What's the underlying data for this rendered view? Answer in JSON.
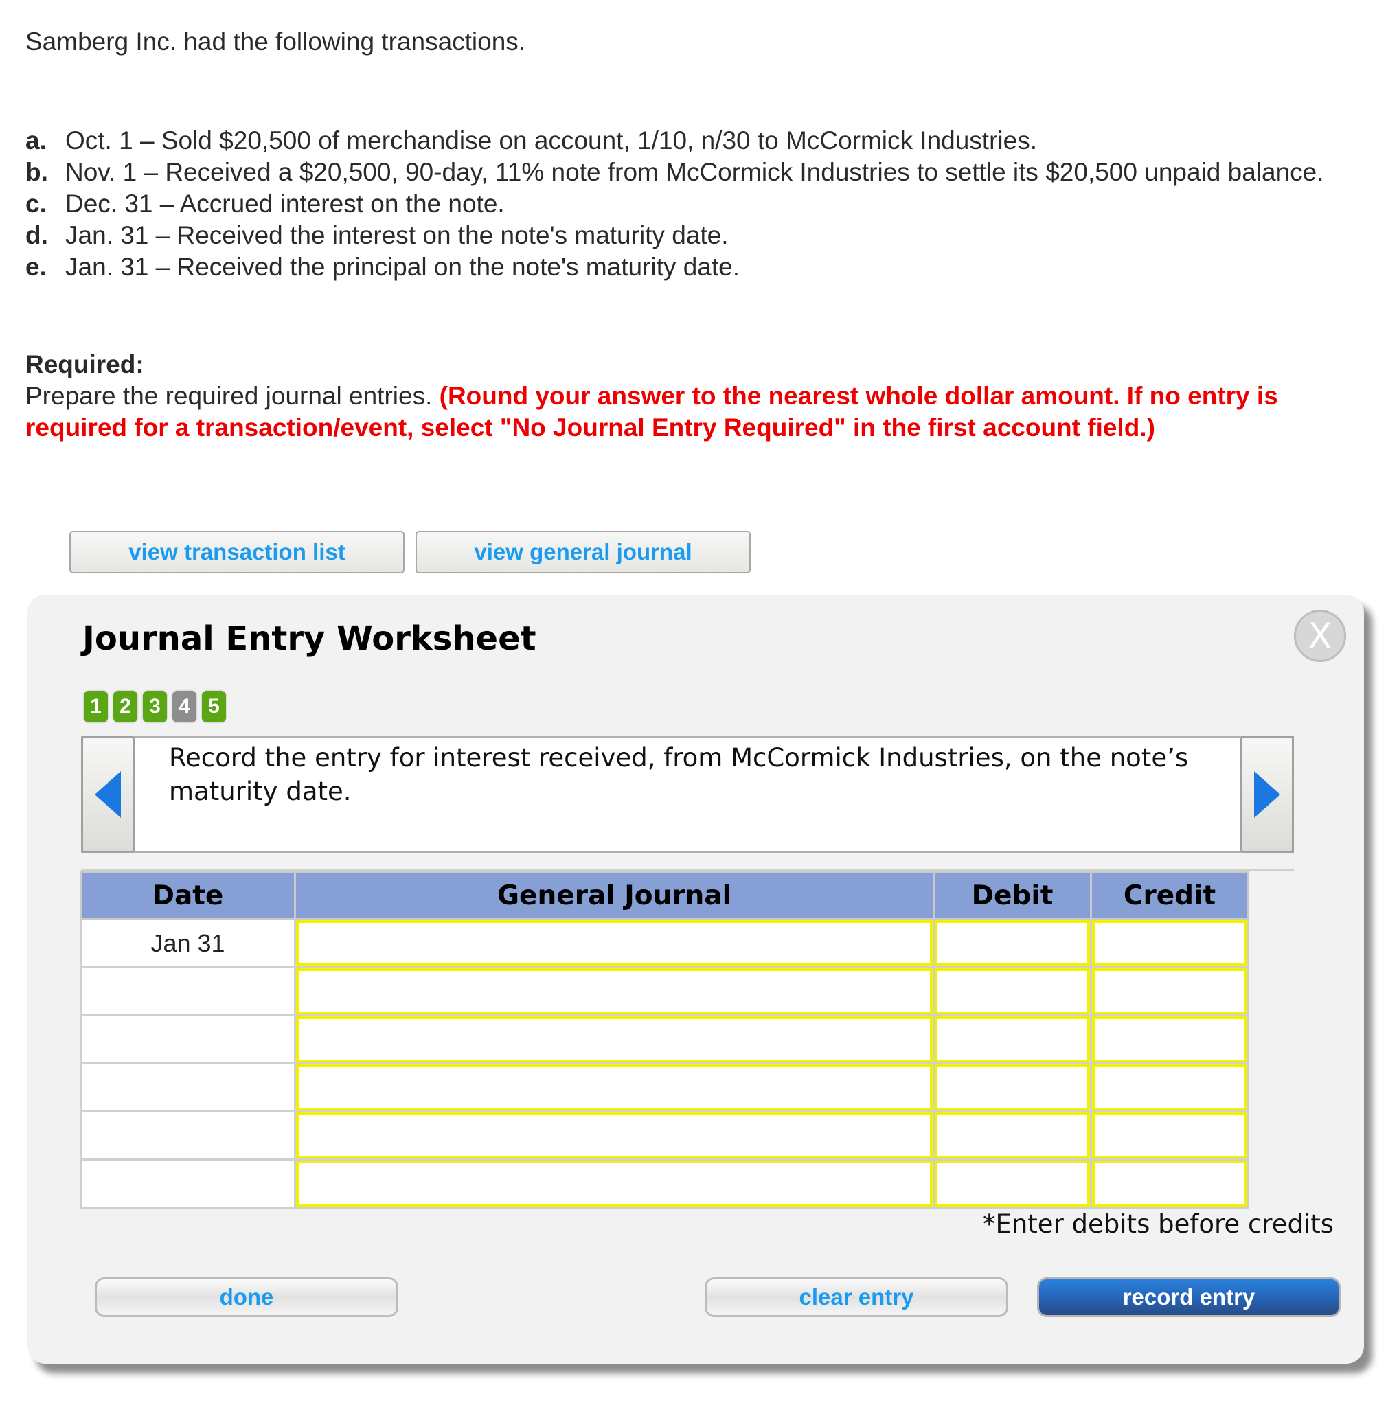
{
  "intro": "Samberg Inc. had the following transactions.",
  "transactions": [
    {
      "letter": "a.",
      "text": "Oct. 1 – Sold $20,500 of merchandise on account, 1/10, n/30 to McCormick Industries."
    },
    {
      "letter": "b.",
      "text": "Nov. 1 – Received a $20,500, 90-day, 11% note from McCormick Industries to settle its $20,500 unpaid balance."
    },
    {
      "letter": "c.",
      "text": "Dec. 31 – Accrued interest on the note."
    },
    {
      "letter": "d.",
      "text": "Jan. 31 – Received the interest on the note's maturity date."
    },
    {
      "letter": "e.",
      "text": "Jan. 31 – Received the principal on the note's maturity date."
    }
  ],
  "required": {
    "title": "Required:",
    "instruction": "Prepare the required journal entries. ",
    "note": "(Round your answer to the nearest whole dollar amount. If no entry is required for a transaction/event, select \"No Journal Entry Required\" in the first account field.)"
  },
  "top_buttons": {
    "view_transaction_list": "view transaction list",
    "view_general_journal": "view general journal"
  },
  "worksheet": {
    "title": "Journal Entry Worksheet",
    "close_label": "X",
    "steps": [
      {
        "label": "1",
        "state": "done"
      },
      {
        "label": "2",
        "state": "done"
      },
      {
        "label": "3",
        "state": "done"
      },
      {
        "label": "4",
        "state": "current"
      },
      {
        "label": "5",
        "state": "done"
      }
    ],
    "prompt": "Record the entry for interest received, from McCormick Industries, on the note’s maturity date.",
    "table": {
      "headers": [
        "Date",
        "General Journal",
        "Debit",
        "Credit"
      ],
      "rows": [
        {
          "date": "Jan 31",
          "account": "",
          "debit": "",
          "credit": ""
        },
        {
          "date": "",
          "account": "",
          "debit": "",
          "credit": ""
        },
        {
          "date": "",
          "account": "",
          "debit": "",
          "credit": ""
        },
        {
          "date": "",
          "account": "",
          "debit": "",
          "credit": ""
        },
        {
          "date": "",
          "account": "",
          "debit": "",
          "credit": ""
        },
        {
          "date": "",
          "account": "",
          "debit": "",
          "credit": ""
        }
      ]
    },
    "hint": "*Enter debits before credits",
    "buttons": {
      "done": "done",
      "clear_entry": "clear entry",
      "record_entry": "record entry"
    }
  },
  "colors": {
    "step_done": "#5aa614",
    "step_current": "#8e8e8e",
    "header_bg": "#86a0d5",
    "input_border": "#f2f200",
    "note_red": "#ee0000",
    "link_blue": "#1a9bf0",
    "record_button": "#2565b8"
  }
}
